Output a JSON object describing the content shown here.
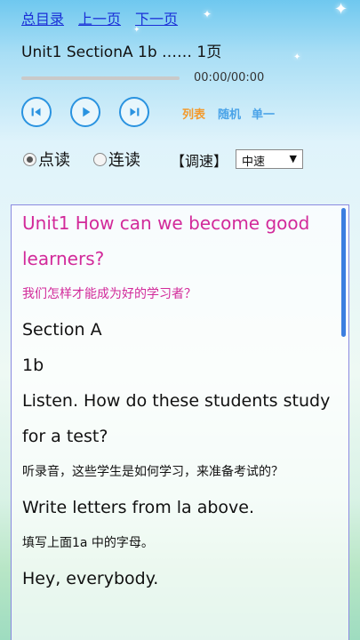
{
  "nav": {
    "links": [
      "总目录",
      "上一页",
      "下一页"
    ]
  },
  "header": {
    "title": "Unit1 SectionA 1b …… 1页"
  },
  "player": {
    "time": "00:00/00:00",
    "progress": 0,
    "modes": [
      "列表",
      "随机",
      "单一"
    ],
    "mode_colors": [
      "#f39a2d",
      "#4aa3e8",
      "#4aa3e8"
    ]
  },
  "options": {
    "read_modes": [
      "点读",
      "连读"
    ],
    "selected_mode": "点读",
    "speed_label": "【调速】",
    "speed_value": "中速"
  },
  "content": {
    "title_en": "Unit1 How can we become good learners?",
    "title_zh": "我们怎样才能成为好的学习者？",
    "lines": [
      {
        "type": "en",
        "text": "Section A"
      },
      {
        "type": "en",
        "text": "1b"
      },
      {
        "type": "en",
        "text": "Listen. How do these students study for a test?"
      },
      {
        "type": "zh",
        "text": "听录音，这些学生是如何学习，来准备考试的？"
      },
      {
        "type": "en",
        "text": "Write letters from la above."
      },
      {
        "type": "zh",
        "text": "填写上面1a 中的字母。"
      },
      {
        "type": "en",
        "text": "Hey, everybody."
      }
    ]
  }
}
